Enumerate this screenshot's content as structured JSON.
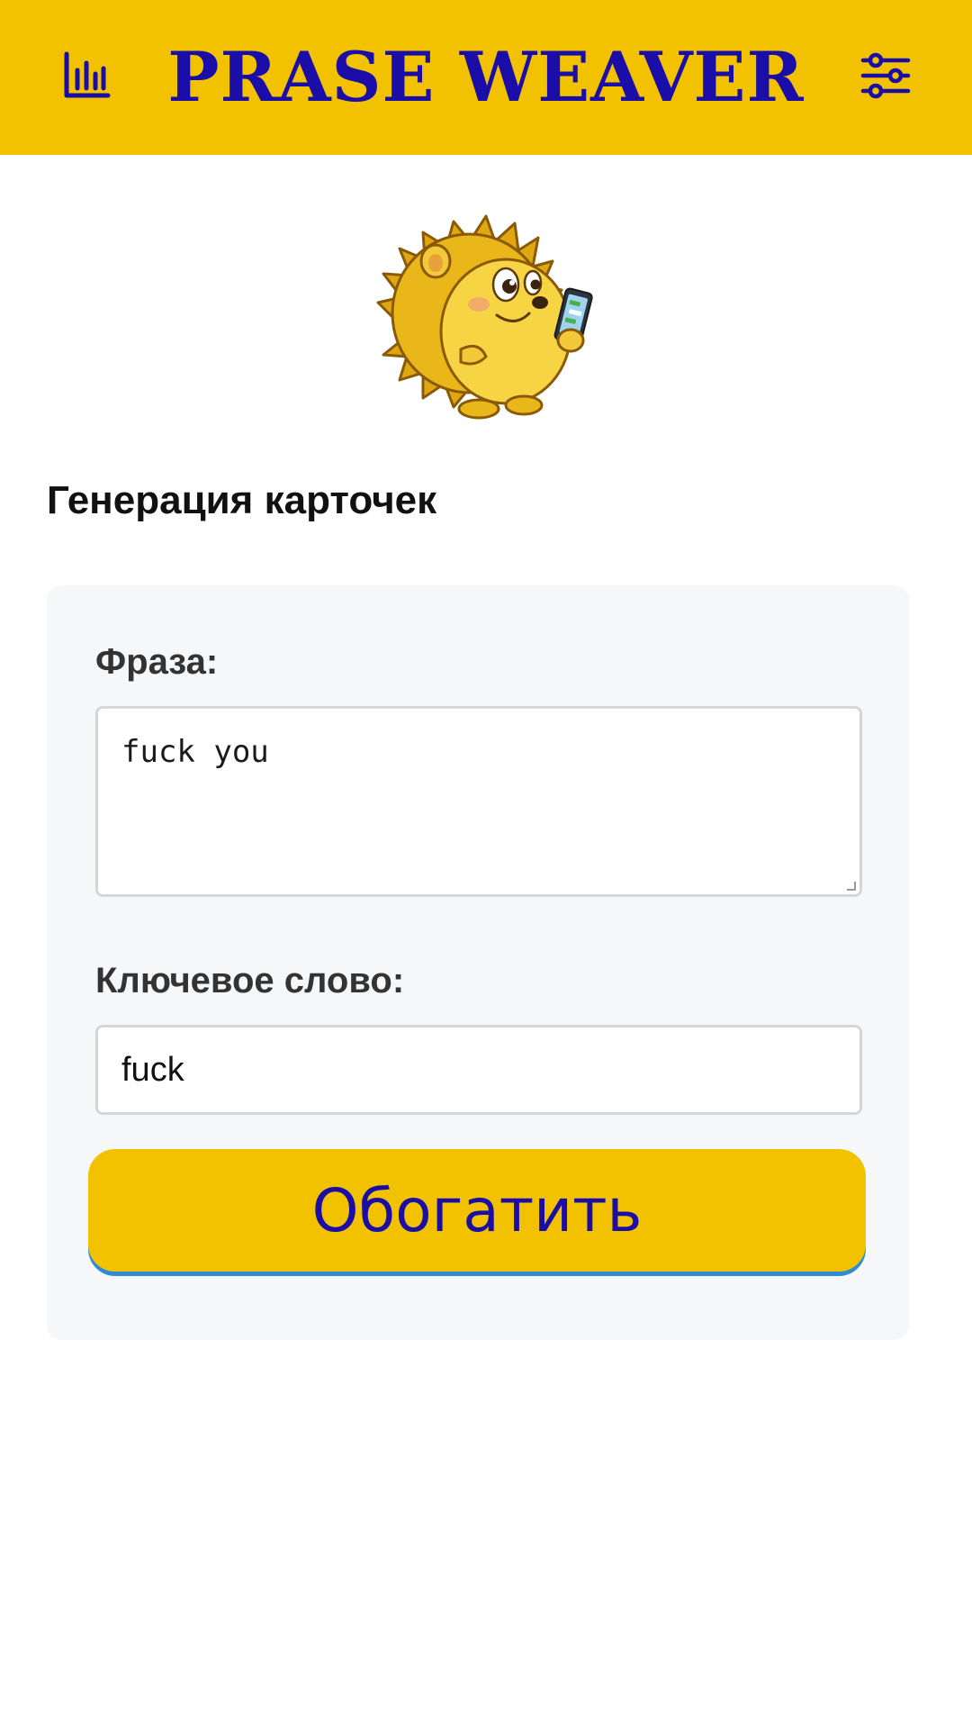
{
  "header": {
    "title": "PRASE WEAVER",
    "left_icon": "bar-chart-icon",
    "right_icon": "sliders-icon"
  },
  "mascot": {
    "icon": "hedgehog-with-phone-mascot"
  },
  "section": {
    "title": "Генерация карточек"
  },
  "form": {
    "phrase_label": "Фраза:",
    "phrase_value": "fuck you",
    "keyword_label": "Ключевое слово:",
    "keyword_value": "fuck",
    "submit_label": "Обогатить"
  },
  "colors": {
    "accent": "#F2C200",
    "title_text": "#1A0DA8",
    "card_bg": "#F6F7F8",
    "button_shadow": "#2E8BD6"
  }
}
